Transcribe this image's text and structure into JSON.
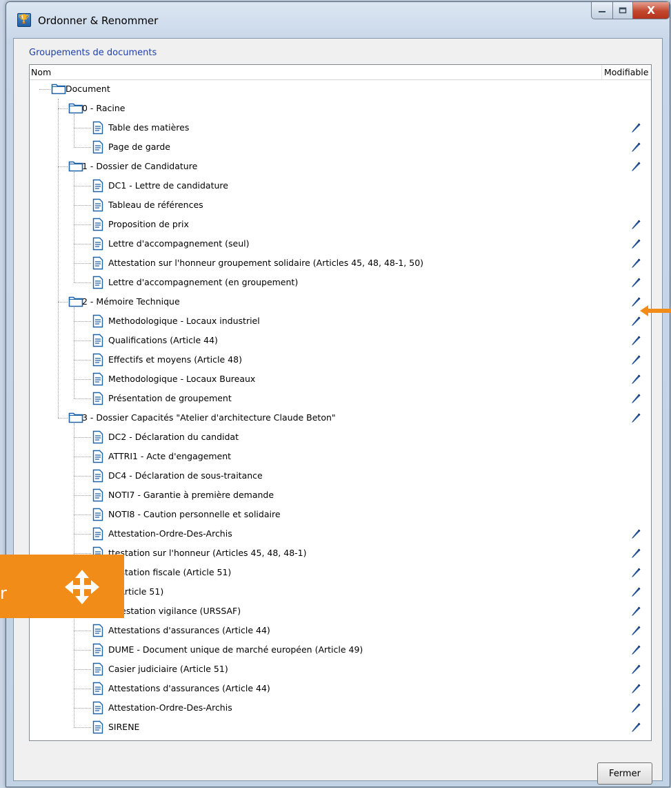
{
  "window": {
    "title": "Ordonner & Renommer",
    "buttons": {
      "minimize": "—",
      "maximize": "▫",
      "close": "X"
    }
  },
  "group_label": "Groupements de documents",
  "columns": {
    "name": "Nom",
    "modifiable": "Modifiable"
  },
  "tree": [
    {
      "level": 0,
      "type": "folder",
      "label": "Document",
      "editable": false
    },
    {
      "level": 1,
      "type": "folder",
      "label": "0 - Racine",
      "editable": false
    },
    {
      "level": 2,
      "type": "doc",
      "label": "Table des matières",
      "editable": true
    },
    {
      "level": 2,
      "type": "doc",
      "label": "Page de garde",
      "editable": true
    },
    {
      "level": 1,
      "type": "folder",
      "label": "1 - Dossier de Candidature",
      "editable": true
    },
    {
      "level": 2,
      "type": "doc",
      "label": "DC1 - Lettre de candidature",
      "editable": false
    },
    {
      "level": 2,
      "type": "doc",
      "label": "Tableau de références",
      "editable": false
    },
    {
      "level": 2,
      "type": "doc",
      "label": "Proposition de prix",
      "editable": true
    },
    {
      "level": 2,
      "type": "doc",
      "label": "Lettre d'accompagnement (seul)",
      "editable": true
    },
    {
      "level": 2,
      "type": "doc",
      "label": "Attestation sur l'honneur groupement solidaire (Articles 45, 48, 48-1, 50)",
      "editable": true
    },
    {
      "level": 2,
      "type": "doc",
      "label": "Lettre d'accompagnement (en groupement)",
      "editable": true
    },
    {
      "level": 1,
      "type": "folder",
      "label": "2 - Mémoire Technique",
      "editable": true
    },
    {
      "level": 2,
      "type": "doc",
      "label": "Methodologique - Locaux industriel",
      "editable": true
    },
    {
      "level": 2,
      "type": "doc",
      "label": "Qualifications (Article 44)",
      "editable": true
    },
    {
      "level": 2,
      "type": "doc",
      "label": "Effectifs et moyens (Article 48)",
      "editable": true
    },
    {
      "level": 2,
      "type": "doc",
      "label": "Methodologique - Locaux Bureaux",
      "editable": true
    },
    {
      "level": 2,
      "type": "doc",
      "label": "Présentation de groupement",
      "editable": true
    },
    {
      "level": 1,
      "type": "folder",
      "label": "3 - Dossier Capacités \"Atelier d'architecture Claude Beton\"",
      "editable": true
    },
    {
      "level": 2,
      "type": "doc",
      "label": "DC2 - Déclaration du candidat",
      "editable": false
    },
    {
      "level": 2,
      "type": "doc",
      "label": "ATTRI1 - Acte d'engagement",
      "editable": false
    },
    {
      "level": 2,
      "type": "doc",
      "label": "DC4 - Déclaration de sous-traitance",
      "editable": false
    },
    {
      "level": 2,
      "type": "doc",
      "label": "NOTI7 - Garantie à première demande",
      "editable": false
    },
    {
      "level": 2,
      "type": "doc",
      "label": "NOTI8 - Caution personnelle et solidaire",
      "editable": false
    },
    {
      "level": 2,
      "type": "doc",
      "label": "Attestation-Ordre-Des-Archis",
      "editable": true
    },
    {
      "level": 2,
      "type": "doc",
      "label": "ttestation sur l'honneur (Articles 45, 48, 48-1)",
      "editable": true
    },
    {
      "level": 2,
      "type": "doc",
      "label": "ttestation fiscale (Article 51)",
      "editable": true
    },
    {
      "level": 2,
      "type": "doc",
      "label": "s (Article 51)",
      "editable": true
    },
    {
      "level": 2,
      "type": "doc",
      "label": "Attestation vigilance (URSSAF)",
      "editable": true
    },
    {
      "level": 2,
      "type": "doc",
      "label": "Attestations d'assurances (Article 44)",
      "editable": true
    },
    {
      "level": 2,
      "type": "doc",
      "label": "DUME - Document unique de marché européen (Article 49)",
      "editable": true
    },
    {
      "level": 2,
      "type": "doc",
      "label": "Casier judiciaire (Article 51)",
      "editable": true
    },
    {
      "level": 2,
      "type": "doc",
      "label": "Attestations d'assurances (Article 44)",
      "editable": true
    },
    {
      "level": 2,
      "type": "doc",
      "label": "Attestation-Ordre-Des-Archis",
      "editable": true
    },
    {
      "level": 2,
      "type": "doc",
      "label": "SIRENE",
      "editable": true
    }
  ],
  "overlay": {
    "text": "r",
    "icon": "move-arrows-icon"
  },
  "pointer": {
    "icon": "orange-arrow-icon",
    "target_row": 11
  },
  "footer": {
    "close_label": "Fermer"
  },
  "colors": {
    "accent_orange": "#f28c18",
    "pencil_blue": "#1f4f8f",
    "link_blue": "#1f3fa8"
  }
}
